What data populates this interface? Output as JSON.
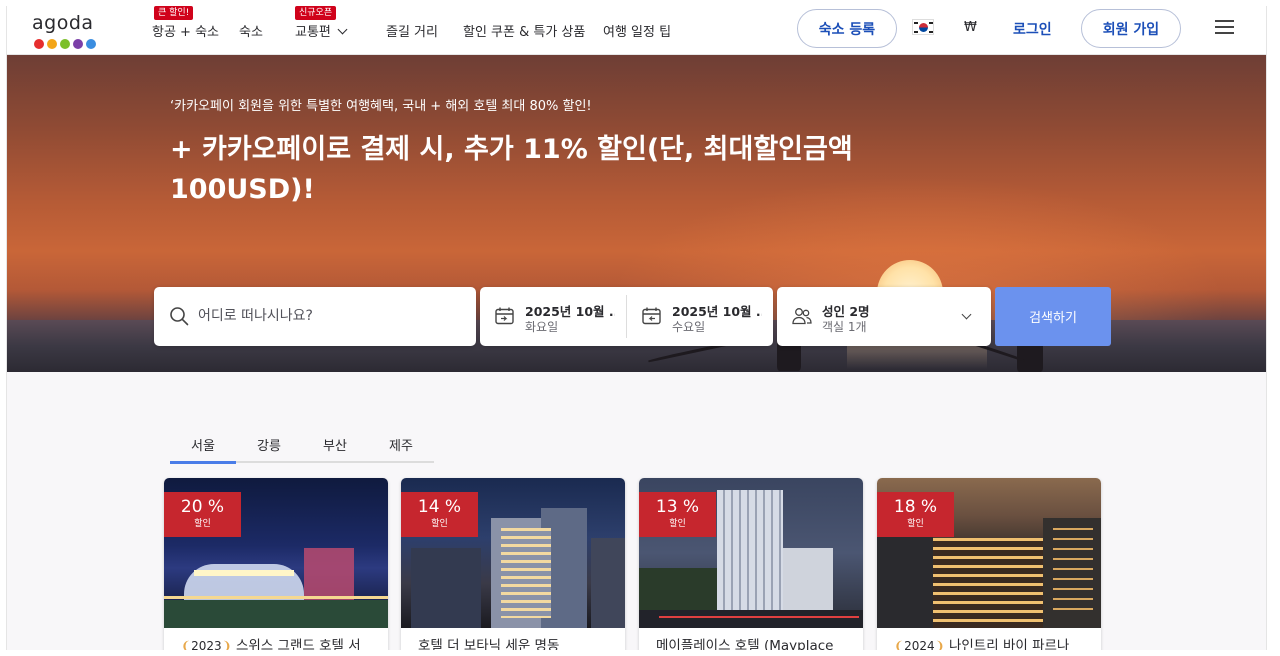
{
  "header": {
    "logo": "agoda",
    "logo_dot_colors": [
      "#e62e2e",
      "#f3a518",
      "#7bbf2a",
      "#7b3fa8",
      "#3a8de0"
    ],
    "nav": [
      {
        "label": "항공 + 숙소",
        "badge": "큰 할인!"
      },
      {
        "label": "숙소",
        "badge": ""
      },
      {
        "label": "교통편",
        "badge": "신규오픈"
      },
      {
        "label": "즐길 거리",
        "badge": ""
      },
      {
        "label": "할인 쿠폰 & 특가 상품",
        "badge": ""
      },
      {
        "label": "여행 일정 팁",
        "badge": ""
      }
    ],
    "list_property": "숙소 등록",
    "currency": "₩",
    "login": "로그인",
    "signup": "회원 가입",
    "accent_color": "#1c4fb8"
  },
  "hero": {
    "subtitle": "‘카카오페이 회원을 위한 특별한 여행혜택, 국내 + 해외 호텔 최대 80% 할인!",
    "title": "+ 카카오페이로 결제 시, 추가 11% 할인(단, 최대할인금액 100USD)!"
  },
  "search": {
    "destination_placeholder": "어디로 떠나시나요?",
    "checkin_date": "2025년 10월 ...",
    "checkin_day": "화요일",
    "checkout_date": "2025년 10월 ...",
    "checkout_day": "수요일",
    "guests": "성인 2명",
    "rooms": "객실 1개",
    "button": "검색하기",
    "button_color": "#6b92ee"
  },
  "tabs": {
    "items": [
      "서울",
      "강릉",
      "부산",
      "제주"
    ],
    "active": 0
  },
  "deals": [
    {
      "discount": "20 %",
      "label": "할인",
      "year": "2023",
      "name": "스위스 그랜드 호텔 서"
    },
    {
      "discount": "14 %",
      "label": "할인",
      "year": "",
      "name": "호텔 더 보타닉 세운 명동"
    },
    {
      "discount": "13 %",
      "label": "할인",
      "year": "",
      "name": "메이플레이스 호텔 (Mayplace"
    },
    {
      "discount": "18 %",
      "label": "할인",
      "year": "2024",
      "name": "나인트리 바이 파르나"
    }
  ],
  "deal_badge_color": "#c6262e"
}
